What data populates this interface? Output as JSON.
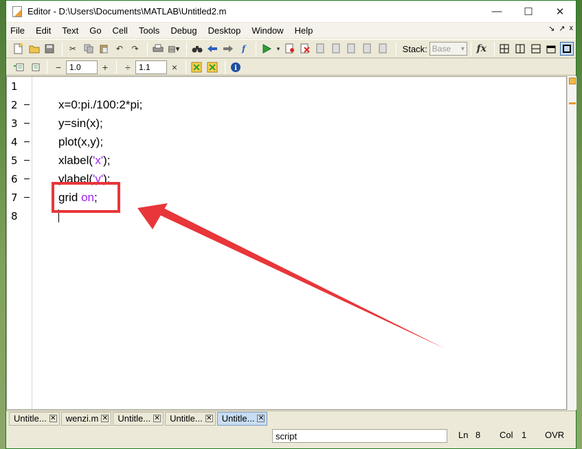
{
  "window": {
    "title": "Editor - D:\\Users\\Documents\\MATLAB\\Untitled2.m",
    "controls": {
      "minimize": "—",
      "maximize": "☐",
      "close": "✕"
    }
  },
  "menu": {
    "items": [
      "File",
      "Edit",
      "Text",
      "Go",
      "Cell",
      "Tools",
      "Debug",
      "Desktop",
      "Window",
      "Help"
    ],
    "right": {
      "undock": "↘",
      "dock": "↗",
      "close": "x"
    }
  },
  "toolbar": {
    "stack_label": "Stack:",
    "stack_value": "Base",
    "fx_label": "fx"
  },
  "cell_toolbar": {
    "minus": "−",
    "value1": "1.0",
    "plus": "+",
    "divide": "÷",
    "value2": "1.1",
    "times": "×"
  },
  "editor": {
    "lines": [
      {
        "num": "1",
        "code": "",
        "bp": false
      },
      {
        "num": "2",
        "code": "x=0:pi./100:2*pi;",
        "bp": true
      },
      {
        "num": "3",
        "code": "y=sin(x);",
        "bp": true
      },
      {
        "num": "4",
        "code": "plot(x,y);",
        "bp": true
      },
      {
        "num": "5",
        "code_pre": "xlabel(",
        "code_str": "'x'",
        "code_post": ");",
        "bp": true
      },
      {
        "num": "6",
        "code_pre": "ylabel(",
        "code_str": "'y'",
        "code_post": ");",
        "bp": true
      },
      {
        "num": "7",
        "code_pre": "grid ",
        "code_kw": "on",
        "code_post": ";",
        "bp": true
      },
      {
        "num": "8",
        "code": "",
        "bp": false
      }
    ]
  },
  "tabs": [
    {
      "label": "Untitle...",
      "active": false
    },
    {
      "label": "wenzi.m",
      "active": false
    },
    {
      "label": "Untitle...",
      "active": false
    },
    {
      "label": "Untitle...",
      "active": false
    },
    {
      "label": "Untitle...",
      "active": true
    }
  ],
  "status": {
    "mode": "script",
    "ln_label": "Ln",
    "ln_value": "8",
    "col_label": "Col",
    "col_value": "1",
    "ovr": "OVR"
  },
  "colors": {
    "keyword": "#a020f0",
    "annotation": "#e8363a"
  }
}
